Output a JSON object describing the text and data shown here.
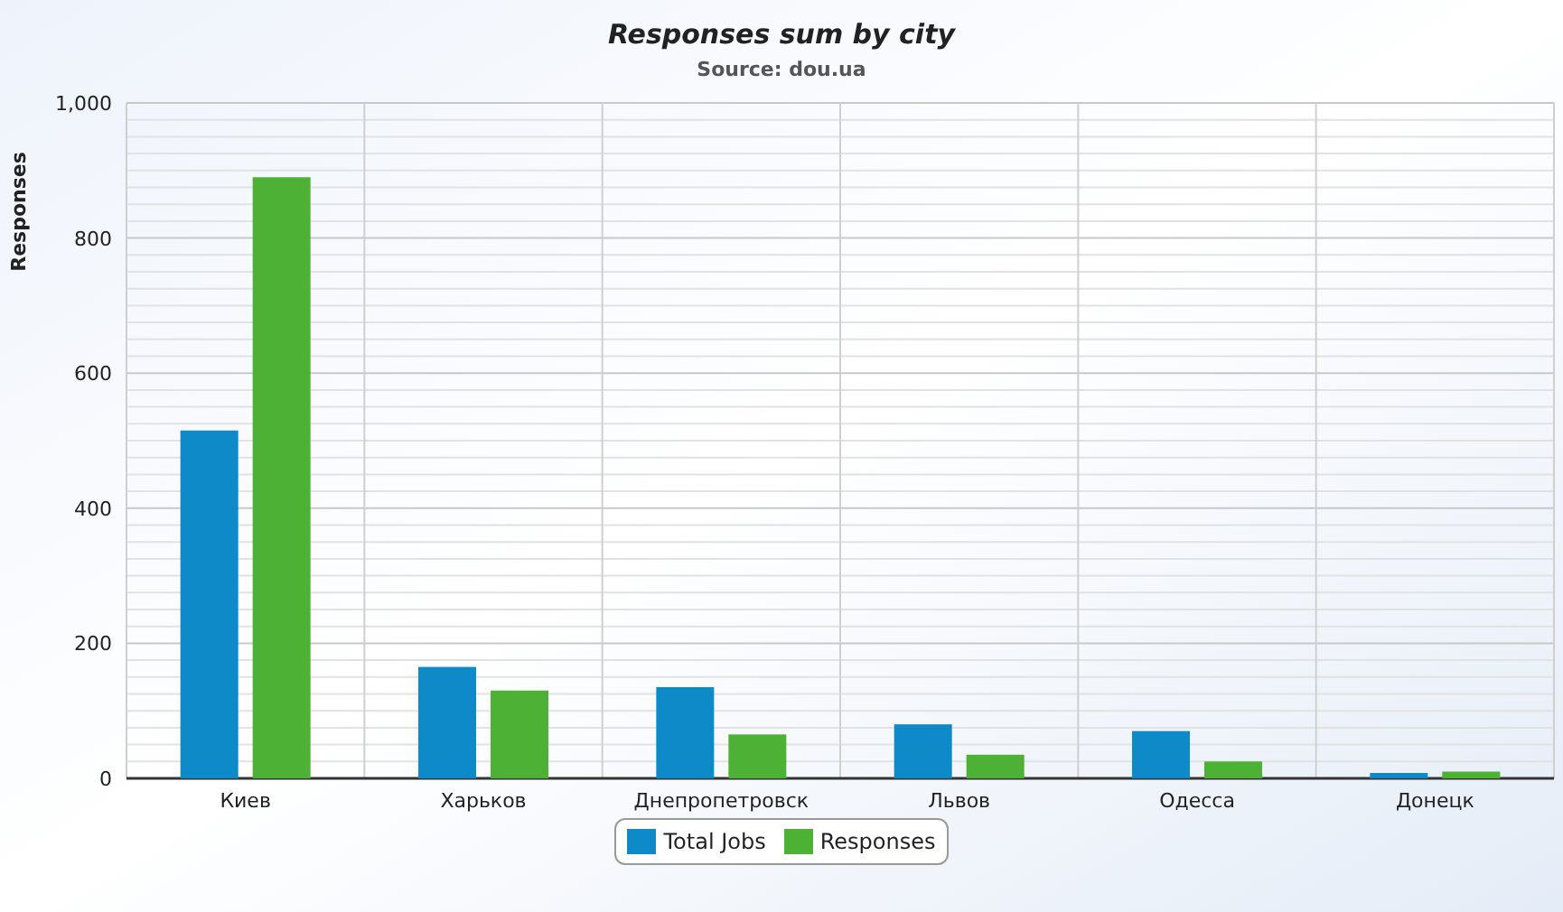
{
  "chart": {
    "title": "Responses sum by city",
    "subtitle": "Source: dou.ua",
    "chart_data": {
      "type": "bar",
      "ylabel": "Responses",
      "categories": [
        "Киев",
        "Харьков",
        "Днепропетровск",
        "Львов",
        "Одесса",
        "Донецк"
      ],
      "series": [
        {
          "name": "Total Jobs",
          "color": "#0e8ac8",
          "values": [
            515,
            165,
            135,
            80,
            70,
            8
          ]
        },
        {
          "name": "Responses",
          "color": "#4cb135",
          "values": [
            890,
            130,
            65,
            35,
            25,
            10
          ]
        }
      ],
      "grid": true,
      "ylim": [
        0,
        1000
      ],
      "yticks": [
        0,
        200,
        400,
        600,
        800,
        {
          "value": 1000,
          "label": "1,000"
        }
      ]
    }
  }
}
